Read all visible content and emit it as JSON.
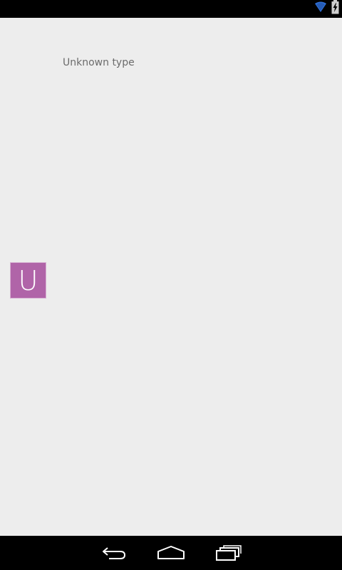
{
  "status_bar": {
    "icons": [
      "wifi-icon",
      "battery-charging-icon"
    ]
  },
  "content": {
    "type_label": "Unknown type",
    "avatar_letter": "U",
    "avatar_color": "#b064a8"
  },
  "nav_bar": {
    "buttons": [
      "back-icon",
      "home-icon",
      "recent-apps-icon"
    ]
  }
}
